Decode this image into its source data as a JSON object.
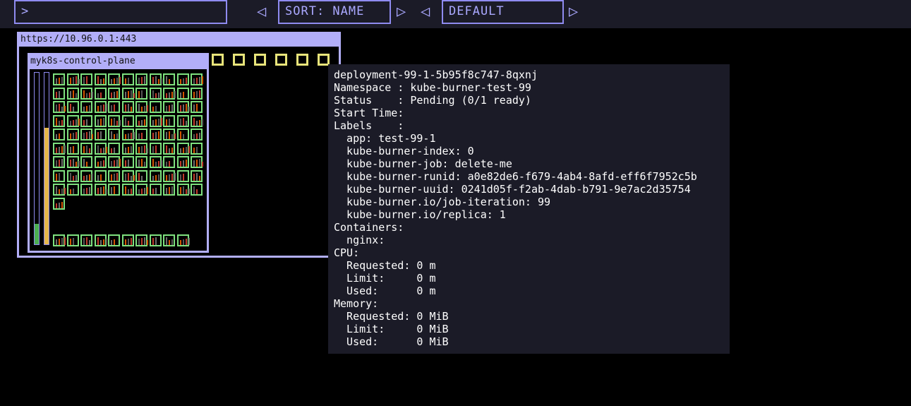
{
  "search": {
    "prompt": ">",
    "value": ""
  },
  "sort": {
    "label": "SORT: NAME",
    "prev_icon": "triangle-left",
    "next_icon": "triangle-right"
  },
  "mode": {
    "label": "DEFAULT",
    "prev_icon": "triangle-left",
    "next_icon": "triangle-right"
  },
  "cluster": {
    "url": "https://10.96.0.1:443"
  },
  "node": {
    "name": "myk8s-control-plane"
  },
  "tooltip": {
    "lines": [
      "deployment-99-1-5b95f8c747-8qxnj",
      "Namespace : kube-burner-test-99",
      "Status    : Pending (0/1 ready)",
      "Start Time:",
      "Labels    :",
      "  app: test-99-1",
      "  kube-burner-index: 0",
      "  kube-burner-job: delete-me",
      "  kube-burner-runid: a0e82de6-f679-4ab4-8afd-eff6f7952c5b",
      "  kube-burner-uuid: 0241d05f-f2ab-4dab-b791-9e7ac2d35754",
      "  kube-burner.io/job-iteration: 99",
      "  kube-burner.io/replica: 1",
      "Containers:",
      "  nginx:",
      "CPU:",
      "  Requested: 0 m",
      "  Limit:     0 m",
      "  Used:      0 m",
      "Memory:",
      "  Requested: 0 MiB",
      "  Limit:     0 MiB",
      "  Used:      0 MiB"
    ]
  },
  "colors": {
    "pod_border": "#7ee07e",
    "empty_pod": "#e8e47a",
    "accent": "#8f8bf0",
    "bar_cpu": "#4caf50",
    "bar_mem": "#e6b84a"
  },
  "levels": {
    "cpu_bar_fraction": 0.12,
    "mem_bar_fraction": 0.68
  }
}
